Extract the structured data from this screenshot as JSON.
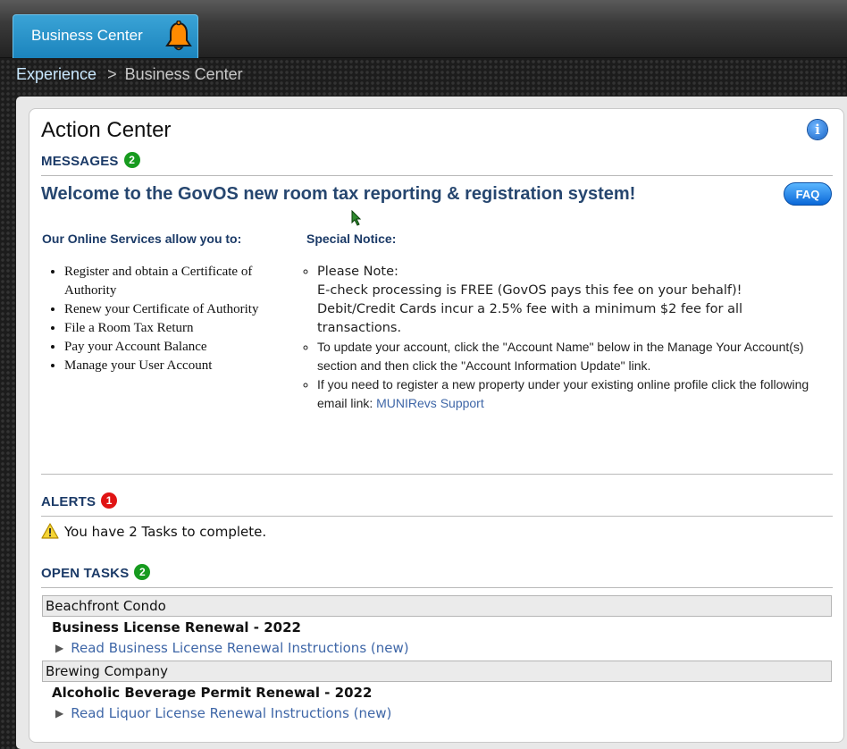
{
  "header": {
    "tab_label": "Business Center",
    "bell_icon": "bell-icon"
  },
  "breadcrumb": {
    "home": "Experience",
    "separator": ">",
    "current": "Business Center"
  },
  "action_center": {
    "title": "Action Center",
    "info_icon": "info-icon",
    "messages": {
      "heading": "MESSAGES",
      "count": "2",
      "welcome": "Welcome to the GovOS new room tax reporting & registration system!",
      "faq_label": "FAQ",
      "services_heading": "Our Online Services allow you to:",
      "services": [
        "Register and obtain a Certificate of Authority",
        "Renew your Certificate of Authority",
        "File a Room Tax Return",
        "Pay your Account Balance",
        "Manage your User Account"
      ],
      "notice_heading": "Special Notice:",
      "notice_1_line_1": "Please Note:",
      "notice_1_line_2": "E-check processing is FREE (GovOS pays this fee on your behalf)!",
      "notice_1_line_3": "Debit/Credit Cards incur a 2.5% fee with a minimum $2 fee for all transactions.",
      "notice_2": "To update your account, click the \"Account Name\" below in the Manage Your Account(s) section and then click the \"Account Information Update\" link.",
      "notice_3_text": "If you need to register a new property under your existing online profile click the following email link: ",
      "notice_3_link": "MUNIRevs Support"
    },
    "alerts": {
      "heading": "ALERTS",
      "count": "1",
      "warning_icon": "warning-icon",
      "message": "You have 2 Tasks to complete."
    },
    "open_tasks": {
      "heading": "OPEN TASKS",
      "count": "2",
      "groups": [
        {
          "name": "Beachfront Condo",
          "task": "Business License Renewal - 2022",
          "link": "Read Business License Renewal Instructions (new)"
        },
        {
          "name": "Brewing Company",
          "task": "Alcoholic Beverage Permit Renewal - 2022",
          "link": "Read Liquor License Renewal Instructions (new)"
        }
      ]
    }
  }
}
